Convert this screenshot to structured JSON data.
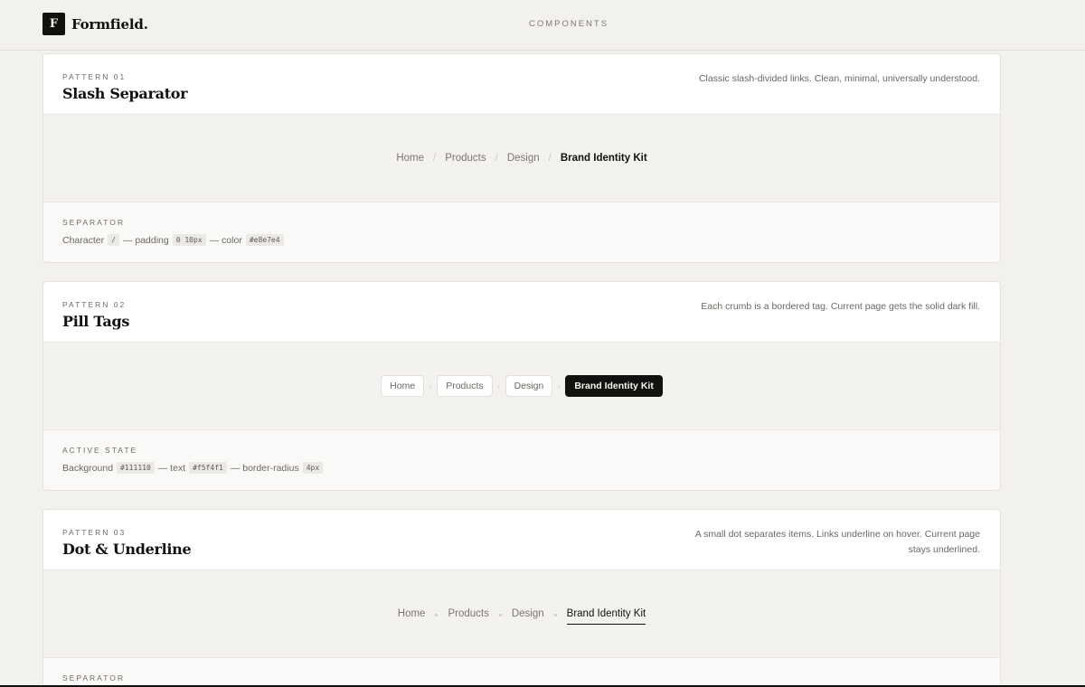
{
  "header": {
    "brand_mark": "F",
    "brand_name": "Formfield.",
    "nav_label": "COMPONENTS"
  },
  "patterns": [
    {
      "eyebrow": "PATTERN 01",
      "title": "Slash Separator",
      "description": "Classic slash-divided links. Clean, minimal, universally understood.",
      "crumbs": [
        "Home",
        "Products",
        "Design"
      ],
      "current": "Brand Identity Kit",
      "separator": "/",
      "spec_label": "SEPARATOR",
      "spec": {
        "t1": "Character",
        "c1": "/",
        "t2": "— padding",
        "c2": "0 10px",
        "t3": "— color",
        "c3": "#e8e7e4"
      }
    },
    {
      "eyebrow": "PATTERN 02",
      "title": "Pill Tags",
      "description": "Each crumb is a bordered tag. Current page gets the solid dark fill.",
      "crumbs": [
        "Home",
        "Products",
        "Design"
      ],
      "current": "Brand Identity Kit",
      "separator": "›",
      "spec_label": "ACTIVE STATE",
      "spec": {
        "t1": "Background",
        "c1": "#111110",
        "t2": "— text",
        "c2": "#f5f4f1",
        "t3": "— border-radius",
        "c3": "4px"
      }
    },
    {
      "eyebrow": "PATTERN 03",
      "title": "Dot & Underline",
      "description": "A small dot separates items. Links underline on hover. Current page stays underlined.",
      "crumbs": [
        "Home",
        "Products",
        "Design"
      ],
      "current": "Brand Identity Kit",
      "spec_label": "SEPARATOR"
    }
  ],
  "colors": {
    "page_bg": "#f3f1ed",
    "ink": "#111110",
    "paper": "#f5f4f1",
    "separator": "#e8e7e4"
  }
}
